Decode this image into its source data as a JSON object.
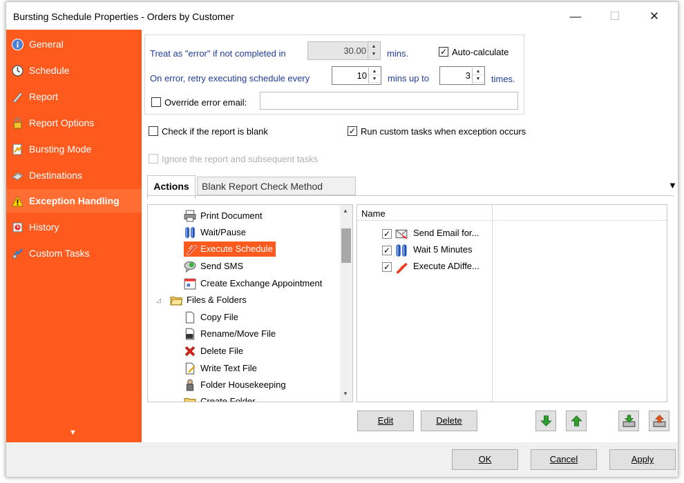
{
  "window": {
    "title": "Bursting Schedule Properties - Orders by Customer",
    "controls": {
      "minimize": "—",
      "maximize": "☐",
      "close": "✕"
    }
  },
  "sidebar": {
    "items": [
      {
        "label": "General",
        "icon": "info-icon"
      },
      {
        "label": "Schedule",
        "icon": "clock-icon"
      },
      {
        "label": "Report",
        "icon": "pen-icon"
      },
      {
        "label": "Report Options",
        "icon": "lock-icon"
      },
      {
        "label": "Bursting Mode",
        "icon": "bursting-icon"
      },
      {
        "label": "Destinations",
        "icon": "destinations-icon"
      },
      {
        "label": "Exception Handling",
        "icon": "warning-icon"
      },
      {
        "label": "History",
        "icon": "history-icon"
      },
      {
        "label": "Custom Tasks",
        "icon": "custom-tasks-icon"
      }
    ],
    "active_index": 6,
    "scroll_arrow": "▼"
  },
  "error_settings": {
    "treat_error_label": "Treat as \"error\" if not completed in",
    "treat_error_value": "30.00",
    "mins_label": "mins.",
    "auto_calculate_label": "Auto-calculate",
    "auto_calculate_checked": true,
    "retry_label": "On error, retry  executing schedule every",
    "retry_value": "10",
    "mins_up_to_label": "mins up to",
    "times_value": "3",
    "times_label": "times.",
    "override_email_label": "Override error email:",
    "override_email_value": "",
    "override_email_checked": false
  },
  "checks": {
    "blank_label": "Check if the report is blank",
    "blank_checked": false,
    "run_custom_label": "Run custom tasks when exception occurs",
    "run_custom_checked": true,
    "ignore_label": "Ignore the report and subsequent tasks",
    "ignore_checked": false
  },
  "tabs": [
    {
      "label": "Actions",
      "active": true
    },
    {
      "label": "Blank Report Check Method",
      "active": false
    }
  ],
  "tab_menu_arrow": "▼",
  "action_tree": [
    {
      "label": "Print Document",
      "icon": "printer-icon",
      "level": 2
    },
    {
      "label": "Wait/Pause",
      "icon": "pause-icon",
      "level": 2
    },
    {
      "label": "Execute Schedule",
      "icon": "execute-icon",
      "level": 2,
      "selected": true
    },
    {
      "label": "Send SMS",
      "icon": "sms-icon",
      "level": 2
    },
    {
      "label": "Create Exchange Appointment",
      "icon": "calendar-icon",
      "level": 2
    },
    {
      "label": "Files & Folders",
      "icon": "folder-icon",
      "level": 1,
      "expander": "◿"
    },
    {
      "label": "Copy File",
      "icon": "file-icon",
      "level": 2
    },
    {
      "label": "Rename/Move File",
      "icon": "rename-file-icon",
      "level": 2
    },
    {
      "label": "Delete File",
      "icon": "delete-icon",
      "level": 2
    },
    {
      "label": "Write Text File",
      "icon": "write-file-icon",
      "level": 2
    },
    {
      "label": "Folder Housekeeping",
      "icon": "housekeeping-icon",
      "level": 2
    },
    {
      "label": "Create Folder",
      "icon": "create-folder-icon",
      "level": 2
    }
  ],
  "task_list": {
    "column_header": "Name",
    "rows": [
      {
        "label": "Send Email for...",
        "icon": "email-icon",
        "checked": true
      },
      {
        "label": "Wait 5 Minutes",
        "icon": "pause-icon",
        "checked": true
      },
      {
        "label": "Execute ADiffe...",
        "icon": "execute-icon",
        "checked": true
      }
    ]
  },
  "task_buttons": {
    "edit": "Edit",
    "delete": "Delete"
  },
  "footer": {
    "ok": "OK",
    "cancel": "Cancel",
    "apply": "Apply"
  },
  "colors": {
    "sidebar": "#fe5a1d",
    "selected": "#fe5a1d",
    "label_blue": "#1f3c9b"
  }
}
